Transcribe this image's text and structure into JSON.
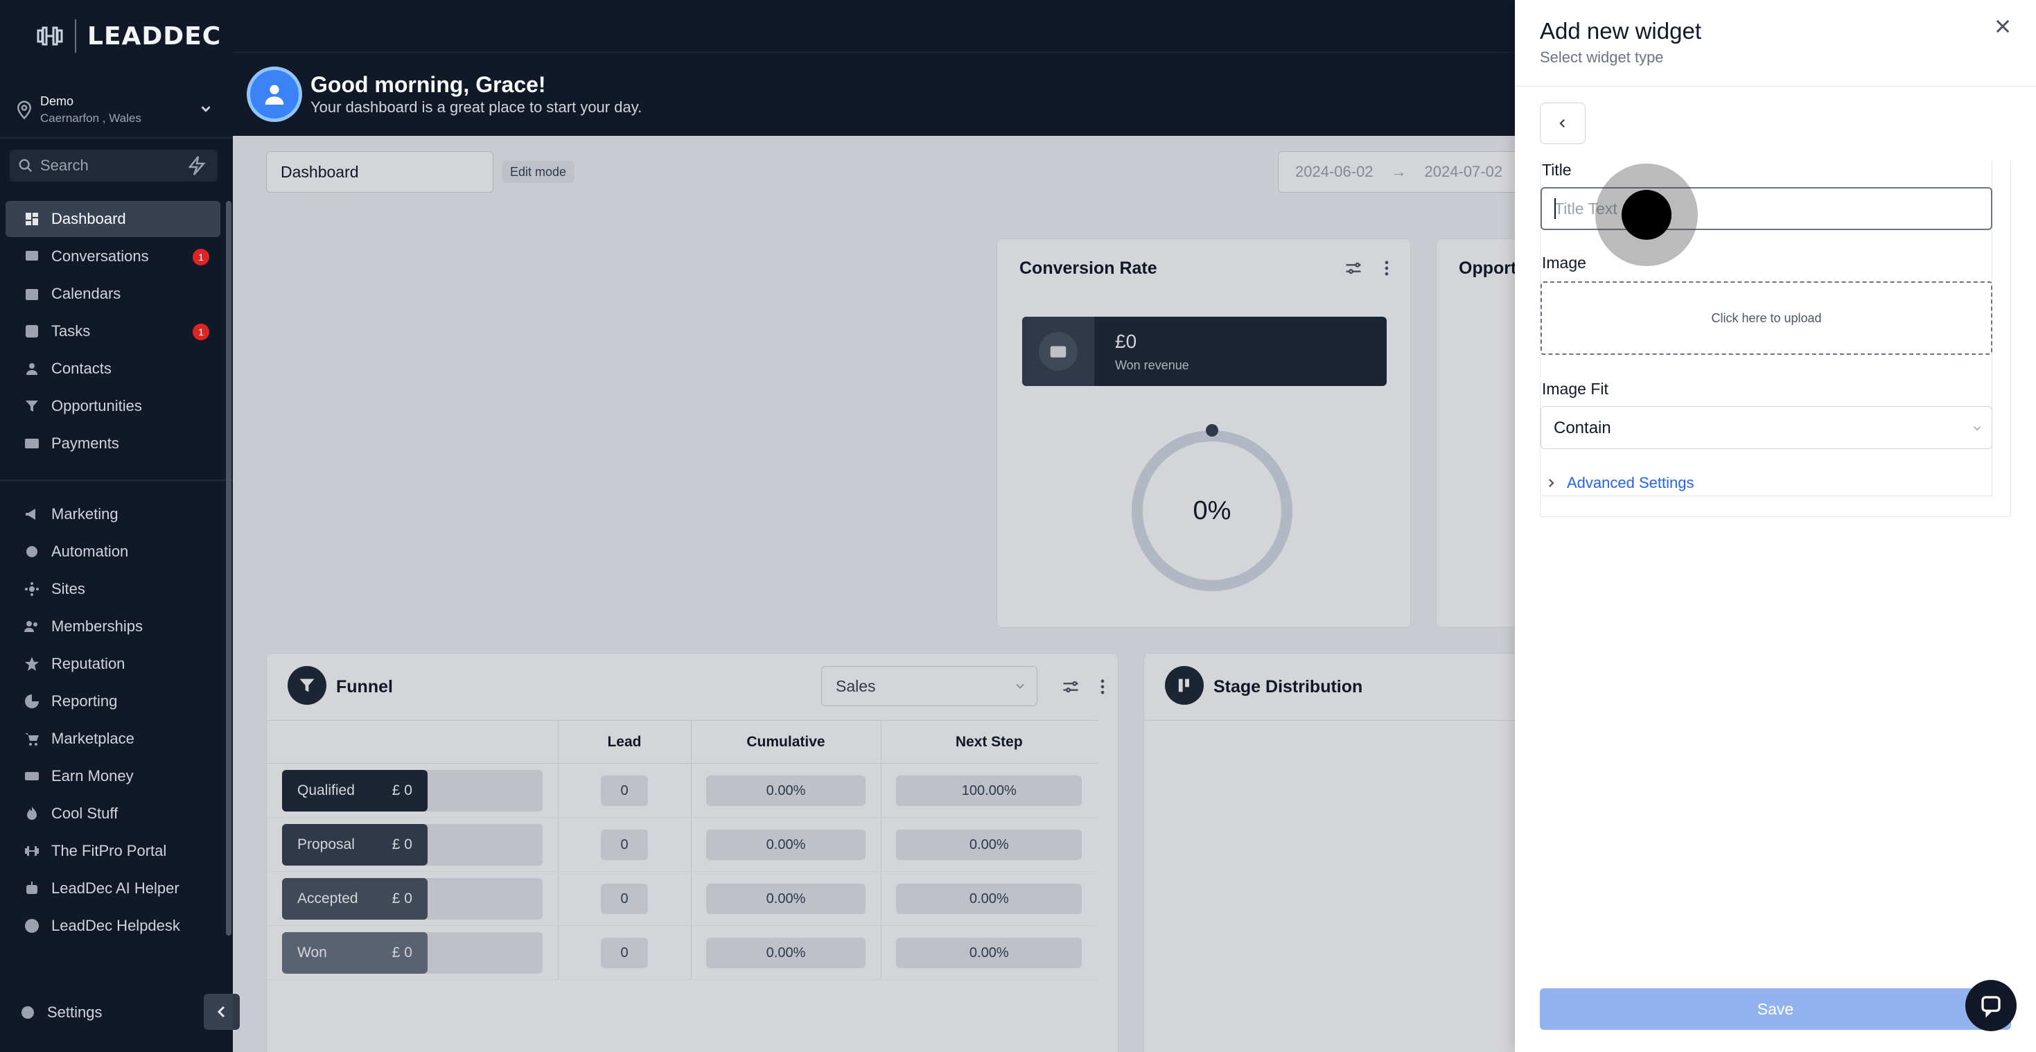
{
  "brand": {
    "name": "LEADDEC"
  },
  "location": {
    "name": "Demo",
    "address": "Caernarfon , Wales"
  },
  "search": {
    "placeholder": "Search"
  },
  "sidebar": {
    "nav_primary": [
      {
        "label": "Dashboard",
        "icon": "dashboard-icon",
        "active": true
      },
      {
        "label": "Conversations",
        "icon": "chat-icon",
        "badge": "1"
      },
      {
        "label": "Calendars",
        "icon": "calendar-icon"
      },
      {
        "label": "Tasks",
        "icon": "checkbox-icon",
        "badge": "1"
      },
      {
        "label": "Contacts",
        "icon": "user-icon"
      },
      {
        "label": "Opportunities",
        "icon": "filter-icon"
      },
      {
        "label": "Payments",
        "icon": "credit-card-icon"
      }
    ],
    "nav_secondary": [
      {
        "label": "Marketing",
        "icon": "megaphone-icon"
      },
      {
        "label": "Automation",
        "icon": "automation-icon"
      },
      {
        "label": "Sites",
        "icon": "sites-icon"
      },
      {
        "label": "Memberships",
        "icon": "memberships-icon"
      },
      {
        "label": "Reputation",
        "icon": "star-icon"
      },
      {
        "label": "Reporting",
        "icon": "chart-icon"
      },
      {
        "label": "Marketplace",
        "icon": "cart-icon"
      },
      {
        "label": "Earn Money",
        "icon": "money-icon"
      },
      {
        "label": "Cool Stuff",
        "icon": "flame-icon"
      },
      {
        "label": "The FitPro Portal",
        "icon": "dumbbell-icon"
      },
      {
        "label": "LeadDec AI Helper",
        "icon": "robot-icon"
      },
      {
        "label": "LeadDec Helpdesk",
        "icon": "info-icon"
      }
    ],
    "settings_label": "Settings"
  },
  "header": {
    "greeting": "Good morning, Grace!",
    "subtitle": "Your dashboard is a great place to start your day."
  },
  "dashboard": {
    "name": "Dashboard",
    "edit_mode": "Edit mode",
    "date_start": "2024-06-02",
    "date_end": "2024-07-02"
  },
  "conversion_card": {
    "title": "Conversion Rate",
    "revenue_value": "£0",
    "revenue_label": "Won revenue",
    "rate": "0%"
  },
  "opportunities_card": {
    "title": "Opport"
  },
  "funnel": {
    "title": "Funnel",
    "pipeline": "Sales",
    "columns": [
      "Lead",
      "Cumulative",
      "Next Step"
    ],
    "rows": [
      {
        "stage": "Qualified",
        "amount": "£ 0",
        "lead": "0",
        "cumulative": "0.00%",
        "next": "100.00%",
        "color": "#1f2937"
      },
      {
        "stage": "Proposal",
        "amount": "£ 0",
        "lead": "0",
        "cumulative": "0.00%",
        "next": "0.00%",
        "color": "#374151"
      },
      {
        "stage": "Accepted",
        "amount": "£ 0",
        "lead": "0",
        "cumulative": "0.00%",
        "next": "0.00%",
        "color": "#4b5563"
      },
      {
        "stage": "Won",
        "amount": "£ 0",
        "lead": "0",
        "cumulative": "0.00%",
        "next": "0.00%",
        "color": "#6b7280"
      }
    ]
  },
  "stage_distribution": {
    "title": "Stage Distribution"
  },
  "drawer": {
    "title": "Add new widget",
    "subtitle": "Select widget type",
    "title_label": "Title",
    "title_placeholder": "Title Text",
    "image_label": "Image",
    "upload_text": "Click here to upload",
    "image_fit_label": "Image Fit",
    "image_fit_value": "Contain",
    "advanced_settings": "Advanced Settings",
    "save_label": "Save"
  }
}
